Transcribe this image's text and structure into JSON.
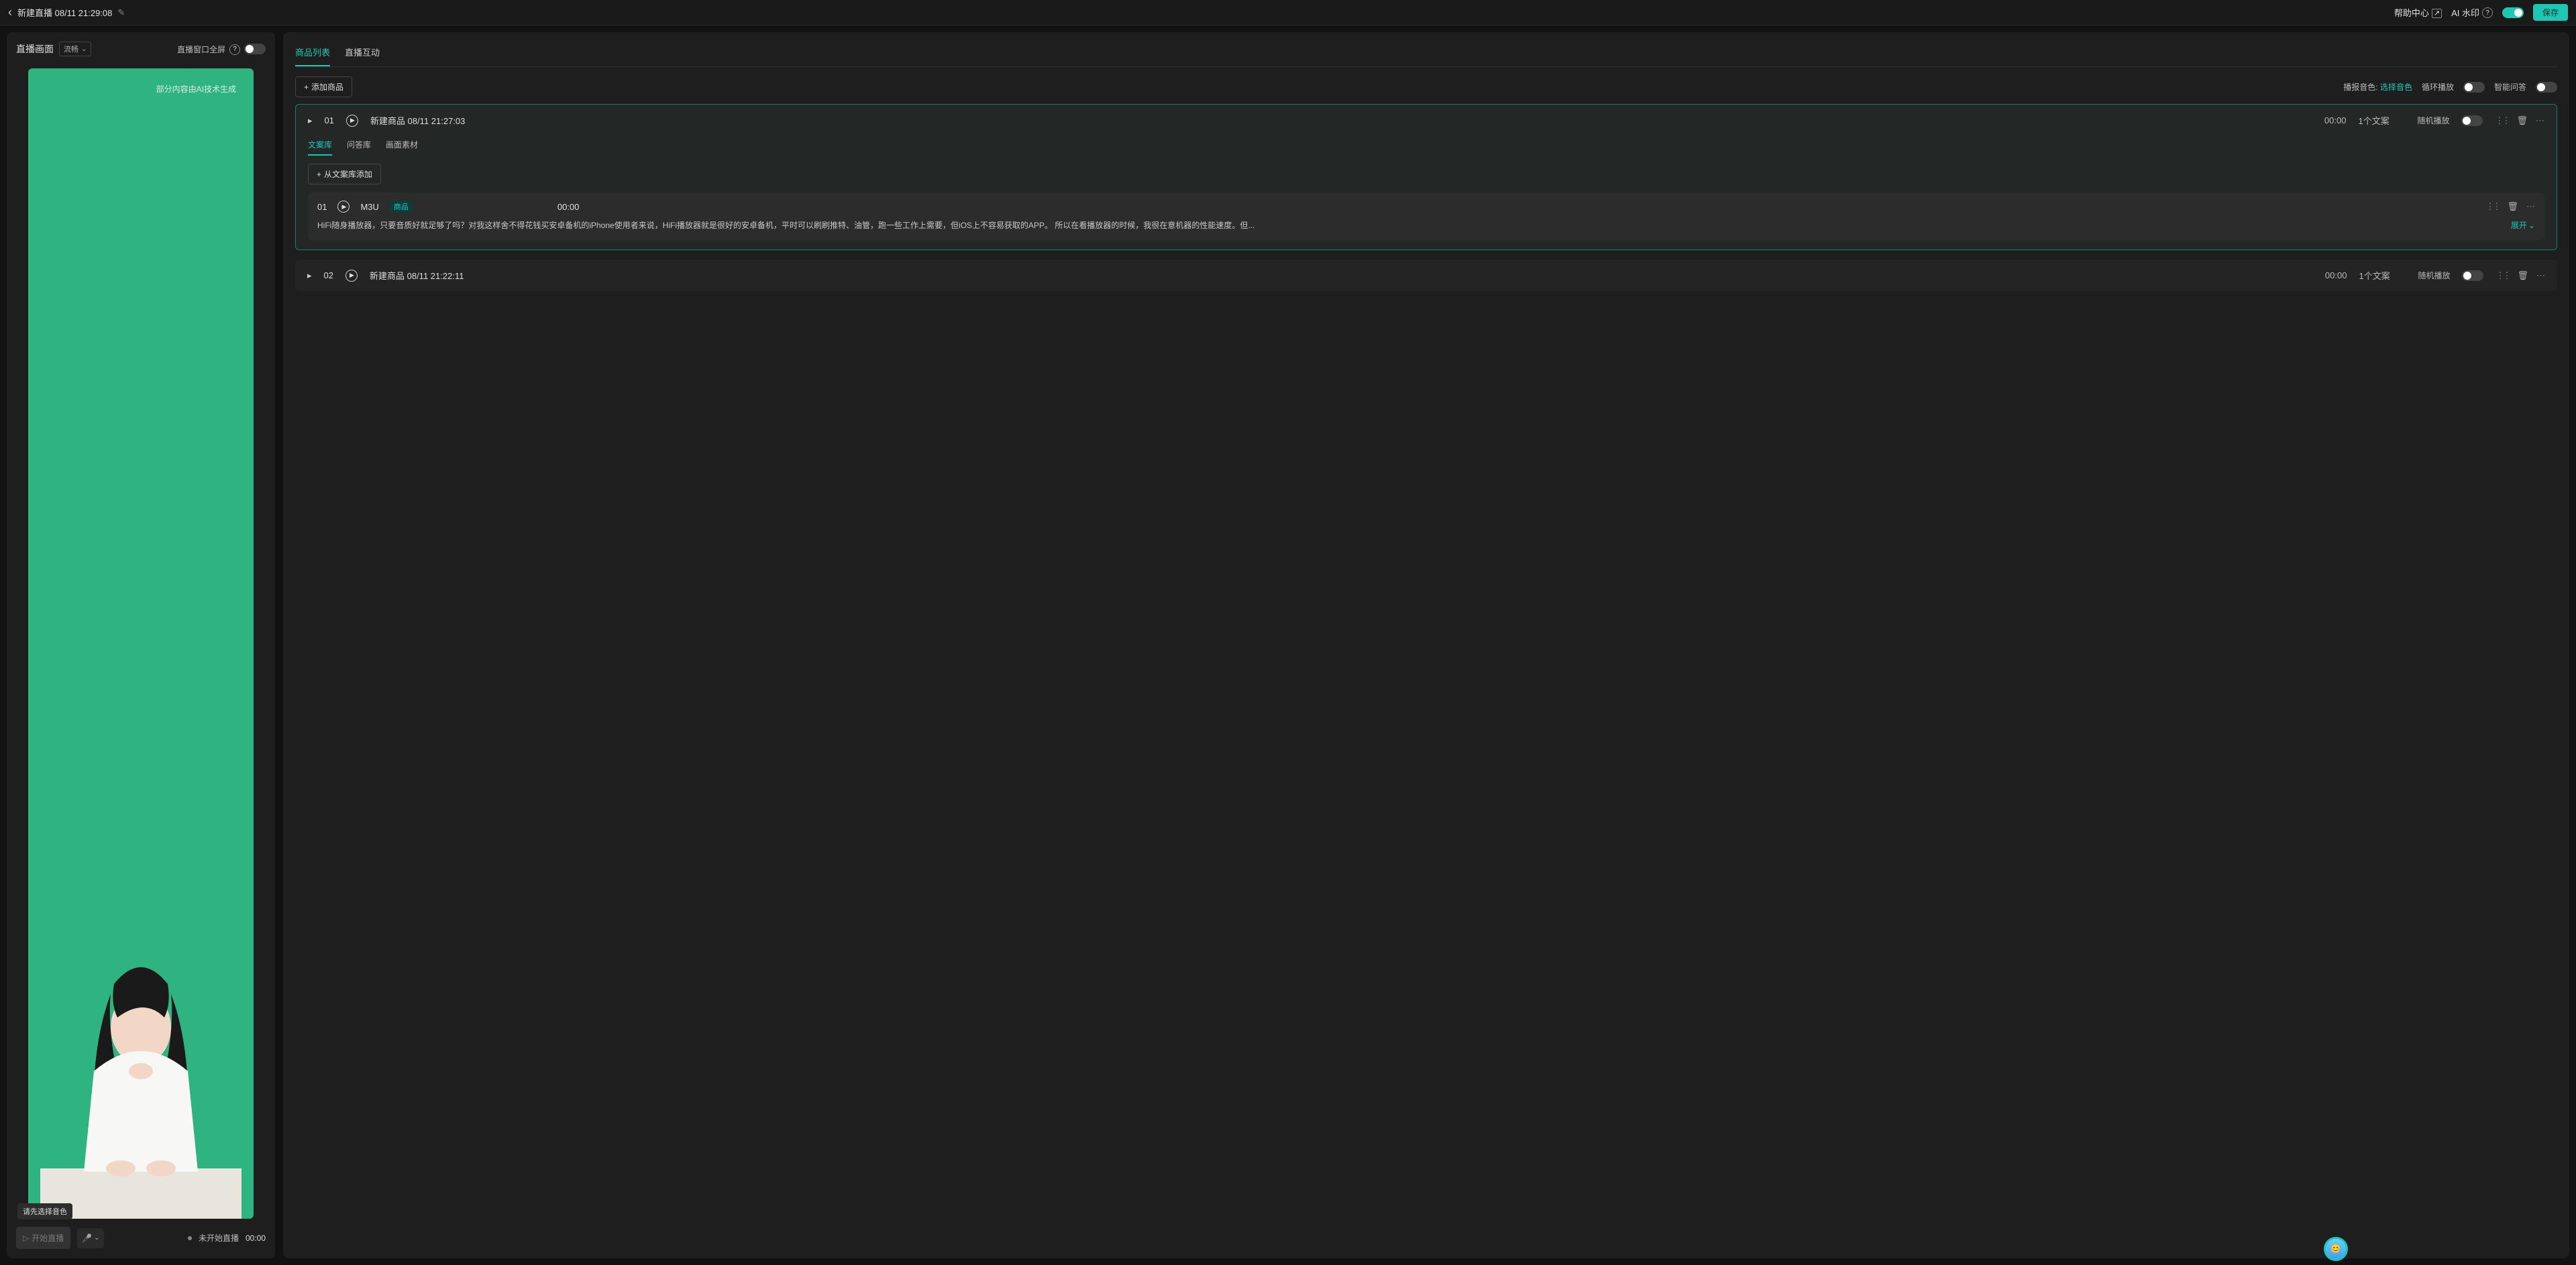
{
  "header": {
    "title": "新建直播 08/11 21:29:08",
    "help_label": "帮助中心",
    "watermark_label": "AI 水印",
    "save_label": "保存",
    "watermark_on": true
  },
  "left": {
    "title": "直播画面",
    "quality_select": "流畅",
    "fullscreen_label": "直播窗口全屏",
    "fullscreen_on": false,
    "ai_overlay": "部分内容由AI技术生成",
    "tooltip": "请先选择音色",
    "start_btn": "开始直播",
    "status": "未开始直播",
    "status_time": "00:00"
  },
  "right": {
    "tabs": [
      "商品列表",
      "直播互动"
    ],
    "add_product": "添加商品",
    "voice_label": "播报音色:",
    "voice_value": "选择音色",
    "loop_label": "循环播放",
    "smart_label": "智能问答"
  },
  "products": [
    {
      "index": "01",
      "title": "新建商品 08/11 21:27:03",
      "time": "00:00",
      "count": "1个文案",
      "random_label": "随机播放",
      "active": true,
      "inner_tabs": [
        "文案库",
        "问答库",
        "画面素材"
      ],
      "add_from_lib": "从文案库添加",
      "script": {
        "index": "01",
        "name": "M3U",
        "tag": "商品",
        "time": "00:00",
        "text": "HiFi随身播放器，只要音质好就足够了吗？对我这样舍不得花钱买安卓备机的iPhone使用者来说，HiFi播放器就是很好的安卓备机，平时可以刷刷推特、油管，跑一些工作上需要，但iOS上不容易获取的APP。 所以在看播放器的时候，我很在意机器的性能速度。但...",
        "expand": "展开"
      }
    },
    {
      "index": "02",
      "title": "新建商品 08/11 21:22:11",
      "time": "00:00",
      "count": "1个文案",
      "random_label": "随机播放",
      "active": false
    }
  ]
}
